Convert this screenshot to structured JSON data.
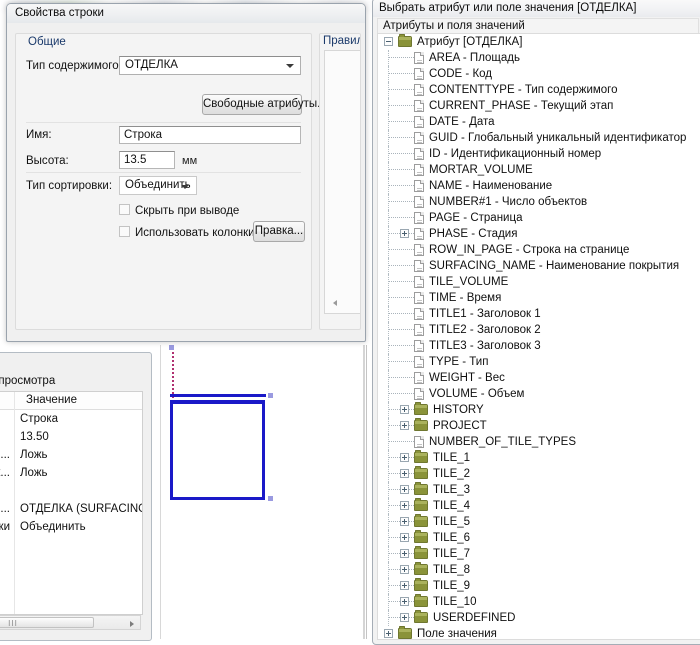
{
  "row_properties_dialog": {
    "title": "Свойства строки",
    "general_group": {
      "title": "Общие",
      "content_type_label": "Тип содержимого:",
      "content_type_value": "ОТДЕЛКА",
      "free_attributes_button": "Свободные атрибуты...",
      "name_label": "Имя:",
      "name_value": "Строка",
      "height_label": "Высота:",
      "height_value": "13.5",
      "height_unit": "мм",
      "sort_type_label": "Тип сортировки:",
      "sort_type_value": "Объединить",
      "hide_on_output_label": "Скрыть при выводе",
      "use_columns_label": "Использовать колонки",
      "edit_button": "Правка..."
    },
    "rule_group": {
      "title": "Правило"
    }
  },
  "preview_window": {
    "caption": "арительного просмотра",
    "grid": {
      "headers": [
        "",
        "Значение"
      ],
      "rows": [
        {
          "name": "",
          "value": "Строка"
        },
        {
          "name": "",
          "value": "13.50"
        },
        {
          "name": "ы...",
          "value": "Ложь"
        },
        {
          "name": "ь к...",
          "value": "Ложь"
        },
        {
          "name": "",
          "value": ""
        },
        {
          "name": "мо...",
          "value": "ОТДЕЛКА (SURFACING)"
        },
        {
          "name": "рки",
          "value": "Объединить"
        }
      ]
    }
  },
  "attribute_window": {
    "title": "Выбрать атрибут или поле значения [ОТДЕЛКА]",
    "subheader": "Атрибуты и поля значений",
    "tree": [
      {
        "depth": 0,
        "icon": "folder-icon",
        "toggle": "minus",
        "name": "Атрибут [ОТДЕЛКА]",
        "sep": "",
        "desc": ""
      },
      {
        "depth": 1,
        "icon": "document-icon",
        "toggle": "none",
        "name": "AREA",
        "sep": "-",
        "desc": "Площадь"
      },
      {
        "depth": 1,
        "icon": "document-icon",
        "toggle": "none",
        "name": "CODE",
        "sep": "-",
        "desc": "Код"
      },
      {
        "depth": 1,
        "icon": "document-icon",
        "toggle": "none",
        "name": "CONTENTTYPE",
        "sep": "-",
        "desc": "Тип содержимого"
      },
      {
        "depth": 1,
        "icon": "document-icon",
        "toggle": "none",
        "name": "CURRENT_PHASE",
        "sep": "-",
        "desc": "Текущий этап"
      },
      {
        "depth": 1,
        "icon": "document-icon",
        "toggle": "none",
        "name": "DATE",
        "sep": "-",
        "desc": "Дата"
      },
      {
        "depth": 1,
        "icon": "document-icon",
        "toggle": "none",
        "name": "GUID",
        "sep": "-",
        "desc": "Глобальный уникальный идентификатор"
      },
      {
        "depth": 1,
        "icon": "document-icon",
        "toggle": "none",
        "name": "ID",
        "sep": "-",
        "desc": "Идентификационный номер"
      },
      {
        "depth": 1,
        "icon": "document-icon",
        "toggle": "none",
        "name": "MORTAR_VOLUME",
        "sep": "",
        "desc": ""
      },
      {
        "depth": 1,
        "icon": "document-icon",
        "toggle": "none",
        "name": "NAME",
        "sep": "-",
        "desc": "Наименование"
      },
      {
        "depth": 1,
        "icon": "document-icon",
        "toggle": "none",
        "name": "NUMBER#1",
        "sep": "-",
        "desc": "Число объектов"
      },
      {
        "depth": 1,
        "icon": "document-icon",
        "toggle": "none",
        "name": "PAGE",
        "sep": "-",
        "desc": "Страница"
      },
      {
        "depth": 1,
        "icon": "document-icon",
        "toggle": "plus",
        "name": "PHASE",
        "sep": "-",
        "desc": "Стадия"
      },
      {
        "depth": 1,
        "icon": "document-icon",
        "toggle": "none",
        "name": "ROW_IN_PAGE",
        "sep": "-",
        "desc": "Строка на странице"
      },
      {
        "depth": 1,
        "icon": "document-icon",
        "toggle": "none",
        "name": "SURFACING_NAME",
        "sep": "-",
        "desc": "Наименование покрытия"
      },
      {
        "depth": 1,
        "icon": "document-icon",
        "toggle": "none",
        "name": "TILE_VOLUME",
        "sep": "",
        "desc": ""
      },
      {
        "depth": 1,
        "icon": "document-icon",
        "toggle": "none",
        "name": "TIME",
        "sep": "-",
        "desc": "Время"
      },
      {
        "depth": 1,
        "icon": "document-icon",
        "toggle": "none",
        "name": "TITLE1",
        "sep": "-",
        "desc": "Заголовок 1"
      },
      {
        "depth": 1,
        "icon": "document-icon",
        "toggle": "none",
        "name": "TITLE2",
        "sep": "-",
        "desc": "Заголовок 2"
      },
      {
        "depth": 1,
        "icon": "document-icon",
        "toggle": "none",
        "name": "TITLE3",
        "sep": "-",
        "desc": "Заголовок 3"
      },
      {
        "depth": 1,
        "icon": "document-icon",
        "toggle": "none",
        "name": "TYPE",
        "sep": "-",
        "desc": "Тип"
      },
      {
        "depth": 1,
        "icon": "document-icon",
        "toggle": "none",
        "name": "WEIGHT",
        "sep": "-",
        "desc": "Вес"
      },
      {
        "depth": 1,
        "icon": "document-icon",
        "toggle": "none",
        "name": "VOLUME",
        "sep": "-",
        "desc": "Объем"
      },
      {
        "depth": 1,
        "icon": "folder-icon",
        "toggle": "plus",
        "name": "HISTORY",
        "sep": "",
        "desc": ""
      },
      {
        "depth": 1,
        "icon": "folder-icon",
        "toggle": "plus",
        "name": "PROJECT",
        "sep": "",
        "desc": ""
      },
      {
        "depth": 1,
        "icon": "document-icon",
        "toggle": "none",
        "name": "NUMBER_OF_TILE_TYPES",
        "sep": "",
        "desc": ""
      },
      {
        "depth": 1,
        "icon": "folder-icon",
        "toggle": "plus",
        "name": "TILE_1",
        "sep": "",
        "desc": ""
      },
      {
        "depth": 1,
        "icon": "folder-icon",
        "toggle": "plus",
        "name": "TILE_2",
        "sep": "",
        "desc": ""
      },
      {
        "depth": 1,
        "icon": "folder-icon",
        "toggle": "plus",
        "name": "TILE_3",
        "sep": "",
        "desc": ""
      },
      {
        "depth": 1,
        "icon": "folder-icon",
        "toggle": "plus",
        "name": "TILE_4",
        "sep": "",
        "desc": ""
      },
      {
        "depth": 1,
        "icon": "folder-icon",
        "toggle": "plus",
        "name": "TILE_5",
        "sep": "",
        "desc": ""
      },
      {
        "depth": 1,
        "icon": "folder-icon",
        "toggle": "plus",
        "name": "TILE_6",
        "sep": "",
        "desc": ""
      },
      {
        "depth": 1,
        "icon": "folder-icon",
        "toggle": "plus",
        "name": "TILE_7",
        "sep": "",
        "desc": ""
      },
      {
        "depth": 1,
        "icon": "folder-icon",
        "toggle": "plus",
        "name": "TILE_8",
        "sep": "",
        "desc": ""
      },
      {
        "depth": 1,
        "icon": "folder-icon",
        "toggle": "plus",
        "name": "TILE_9",
        "sep": "",
        "desc": ""
      },
      {
        "depth": 1,
        "icon": "folder-icon",
        "toggle": "plus",
        "name": "TILE_10",
        "sep": "",
        "desc": ""
      },
      {
        "depth": 1,
        "icon": "folder-icon",
        "toggle": "plus",
        "name": "USERDEFINED",
        "sep": "",
        "desc": ""
      },
      {
        "depth": 0,
        "icon": "folder-icon",
        "toggle": "plus",
        "name": "Поле значения",
        "sep": "",
        "desc": ""
      }
    ]
  },
  "colors": {
    "cad_element": "#1a19c8",
    "cad_guide": "#b03070",
    "folder_icon": "#8a9339",
    "group_title": "#1b3a6b"
  }
}
